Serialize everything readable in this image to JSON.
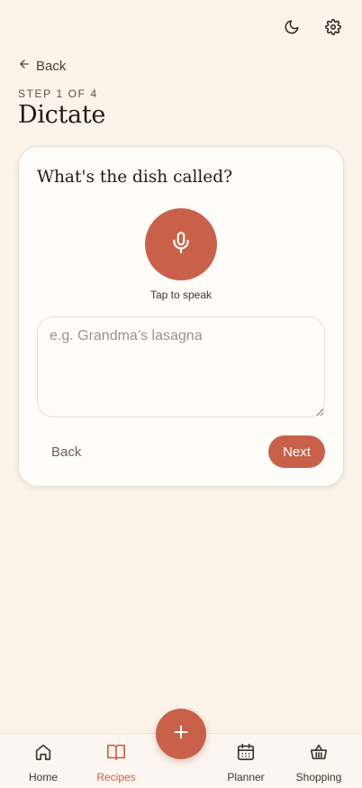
{
  "header": {
    "back_label": "Back",
    "step_label": "STEP 1 OF 4",
    "title": "Dictate",
    "icons": [
      "moon-icon",
      "gear-icon"
    ]
  },
  "card": {
    "question": "What's the dish called?",
    "mic_caption": "Tap to speak",
    "input_placeholder": "e.g. Grandma’s lasagna",
    "input_value": "",
    "back_label": "Back",
    "next_label": "Next"
  },
  "nav": {
    "items": [
      {
        "label": "Home",
        "icon": "home-icon",
        "active": false
      },
      {
        "label": "Recipes",
        "icon": "book-icon",
        "active": true
      },
      {
        "label": "Planner",
        "icon": "calendar-icon",
        "active": false
      },
      {
        "label": "Shopping",
        "icon": "basket-icon",
        "active": false
      }
    ],
    "fab_icon": "plus-icon"
  },
  "colors": {
    "background": "#fcf3ea",
    "accent": "#c9614a",
    "card": "#fffdfa"
  }
}
